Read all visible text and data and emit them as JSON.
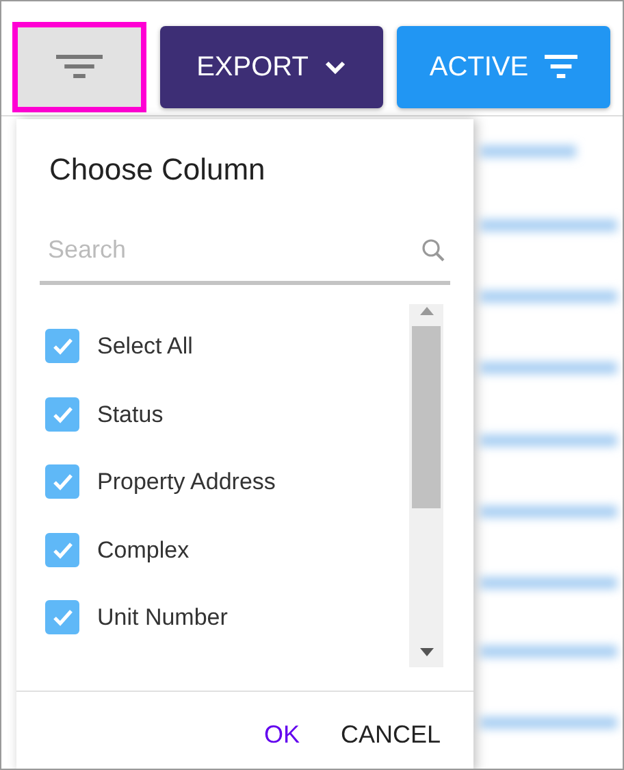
{
  "toolbar": {
    "buttons": [
      {
        "kind": "filter",
        "selected": true
      },
      {
        "kind": "dropdown",
        "label": "EXPORT",
        "selected": false
      },
      {
        "kind": "filter-label",
        "label": "ACTIVE",
        "selected": false
      }
    ]
  },
  "column_chooser": {
    "title": "Choose Column",
    "search": {
      "placeholder": "Search"
    },
    "options": [
      {
        "label": "Select All",
        "checked": true
      },
      {
        "label": "Status",
        "checked": true
      },
      {
        "label": "Property Address",
        "checked": true
      },
      {
        "label": "Complex",
        "checked": true
      },
      {
        "label": "Unit Number",
        "checked": true
      }
    ],
    "actions": [
      {
        "label": "OK",
        "kind": "primary"
      },
      {
        "label": "CANCEL",
        "kind": "secondary"
      }
    ]
  }
}
